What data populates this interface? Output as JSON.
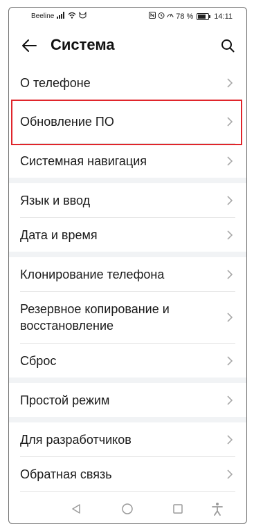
{
  "status_bar": {
    "carrier": "Beeline",
    "battery": "78 %",
    "battery_level": 0.78,
    "time": "14:11"
  },
  "header": {
    "title": "Система"
  },
  "groups": [
    {
      "items": [
        "О телефоне",
        "Обновление ПО",
        "Системная навигация"
      ]
    },
    {
      "items": [
        "Язык и ввод",
        "Дата и время"
      ]
    },
    {
      "items": [
        "Клонирование телефона",
        "Резервное копирование и восстановление",
        "Сброс"
      ]
    },
    {
      "items": [
        "Простой режим"
      ]
    },
    {
      "items": [
        "Для разработчиков",
        "Обратная связь"
      ]
    }
  ],
  "highlight_color": "#e0252b",
  "icons": {
    "back": "arrow-left-icon",
    "search": "search-icon",
    "chevron": "chevron-right-icon",
    "nav_back": "triangle-back-icon",
    "nav_home": "circle-home-icon",
    "nav_recent": "square-recent-icon",
    "accessibility": "accessibility-icon"
  }
}
